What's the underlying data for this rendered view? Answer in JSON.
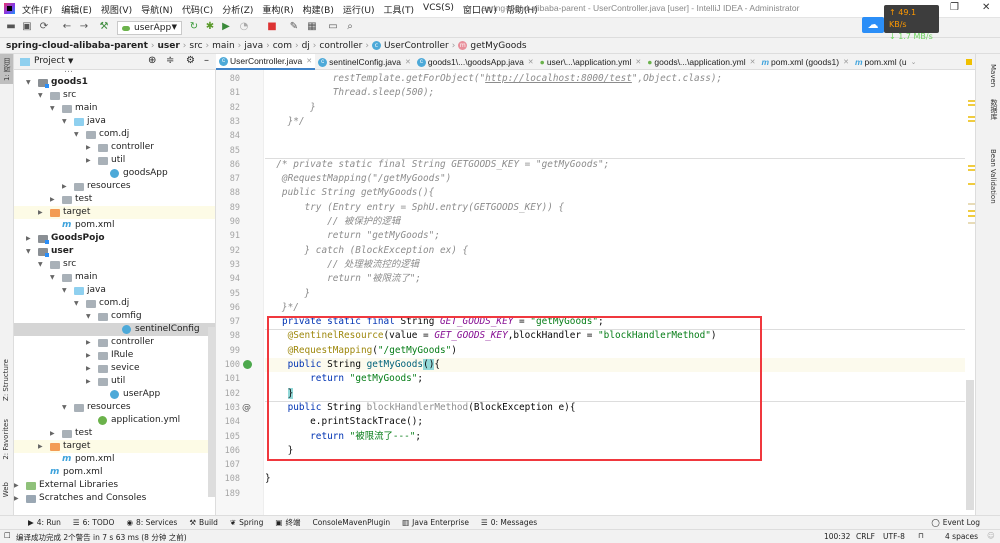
{
  "window": {
    "title": "spring-cloud-alibaba-parent - UserController.java [user] - IntelliJ IDEA - Administrator",
    "menu": [
      "文件(F)",
      "编辑(E)",
      "视图(V)",
      "导航(N)",
      "代码(C)",
      "分析(Z)",
      "重构(R)",
      "构建(B)",
      "运行(U)",
      "工具(T)",
      "VCS(S)",
      "窗口(W)",
      "帮助(H)"
    ]
  },
  "network": {
    "up": "↑ 49.1 KB/s",
    "down": "↓ 1.7 MB/s"
  },
  "toolbar": {
    "run_config": "userApp"
  },
  "breadcrumb": [
    "spring-cloud-alibaba-parent",
    "user",
    "src",
    "main",
    "java",
    "com",
    "dj",
    "controller",
    "UserController",
    "getMyGoods"
  ],
  "project_panel": {
    "title": "Project",
    "tree": [
      {
        "label": "goods1",
        "depth": 1,
        "icon": "mod",
        "open": true,
        "bold": true
      },
      {
        "label": "src",
        "depth": 2,
        "icon": "folder",
        "open": true
      },
      {
        "label": "main",
        "depth": 3,
        "icon": "folder",
        "open": true
      },
      {
        "label": "java",
        "depth": 4,
        "icon": "src",
        "open": true
      },
      {
        "label": "com.dj",
        "depth": 5,
        "icon": "folder",
        "open": true
      },
      {
        "label": "controller",
        "depth": 6,
        "icon": "folder",
        "open": false
      },
      {
        "label": "util",
        "depth": 6,
        "icon": "folder",
        "open": false
      },
      {
        "label": "goodsApp",
        "depth": 7,
        "icon": "cls"
      },
      {
        "label": "resources",
        "depth": 4,
        "icon": "folder",
        "open": false
      },
      {
        "label": "test",
        "depth": 3,
        "icon": "folder",
        "open": false
      },
      {
        "label": "target",
        "depth": 2,
        "icon": "orange",
        "open": false,
        "highlight": true
      },
      {
        "label": "pom.xml",
        "depth": 3,
        "icon": "m"
      },
      {
        "label": "GoodsPojo",
        "depth": 1,
        "icon": "mod",
        "open": false,
        "bold": true
      },
      {
        "label": "user",
        "depth": 1,
        "icon": "mod",
        "open": true,
        "bold": true
      },
      {
        "label": "src",
        "depth": 2,
        "icon": "folder",
        "open": true
      },
      {
        "label": "main",
        "depth": 3,
        "icon": "folder",
        "open": true
      },
      {
        "label": "java",
        "depth": 4,
        "icon": "src",
        "open": true
      },
      {
        "label": "com.dj",
        "depth": 5,
        "icon": "folder",
        "open": true
      },
      {
        "label": "comfig",
        "depth": 6,
        "icon": "folder",
        "open": true
      },
      {
        "label": "sentinelConfig",
        "depth": 8,
        "icon": "cls",
        "selected": true
      },
      {
        "label": "controller",
        "depth": 6,
        "icon": "folder",
        "open": false
      },
      {
        "label": "IRule",
        "depth": 6,
        "icon": "folder",
        "open": false
      },
      {
        "label": "sevice",
        "depth": 6,
        "icon": "folder",
        "open": false
      },
      {
        "label": "util",
        "depth": 6,
        "icon": "folder",
        "open": false
      },
      {
        "label": "userApp",
        "depth": 7,
        "icon": "cls"
      },
      {
        "label": "resources",
        "depth": 4,
        "icon": "folder",
        "open": true
      },
      {
        "label": "application.yml",
        "depth": 6,
        "icon": "yml"
      },
      {
        "label": "test",
        "depth": 3,
        "icon": "folder",
        "open": false
      },
      {
        "label": "target",
        "depth": 2,
        "icon": "orange",
        "open": false,
        "highlight": true
      },
      {
        "label": "pom.xml",
        "depth": 3,
        "icon": "m"
      },
      {
        "label": "pom.xml",
        "depth": 2,
        "icon": "m"
      },
      {
        "label": "External Libraries",
        "depth": 0,
        "icon": "lib",
        "open": false
      },
      {
        "label": "Scratches and Consoles",
        "depth": 0,
        "icon": "scr",
        "open": false
      }
    ]
  },
  "tabs": [
    {
      "label": "UserController.java",
      "icon": "c",
      "active": true
    },
    {
      "label": "sentinelConfig.java",
      "icon": "c"
    },
    {
      "label": "goods1\\...\\goodsApp.java",
      "icon": "c"
    },
    {
      "label": "user\\...\\application.yml",
      "icon": "yml"
    },
    {
      "label": "goods\\...\\application.yml",
      "icon": "yml"
    },
    {
      "label": "pom.xml (goods1)",
      "icon": "m"
    },
    {
      "label": "pom.xml (u",
      "icon": "m"
    }
  ],
  "editor": {
    "lines": [
      {
        "n": "80",
        "t": [
          [
            "            restTemplate.getForObject(\"",
            "c"
          ],
          [
            "http://localhost:8000/test",
            "cu"
          ],
          [
            "\",Object.class);",
            "c"
          ]
        ]
      },
      {
        "n": "81",
        "t": [
          [
            "            Thread.sleep(500);",
            "c"
          ]
        ]
      },
      {
        "n": "82",
        "t": [
          [
            "        }",
            "c"
          ]
        ]
      },
      {
        "n": "83",
        "t": [
          [
            "    }*/",
            "c"
          ]
        ]
      },
      {
        "n": "84",
        "t": []
      },
      {
        "n": "85",
        "t": []
      },
      {
        "n": "86",
        "t": [
          [
            "  /* private static final String GETGOODS_KEY = \"getMyGoods\";",
            "c"
          ]
        ]
      },
      {
        "n": "87",
        "t": [
          [
            "   @RequestMapping(\"/getMyGoods\")",
            "c"
          ]
        ]
      },
      {
        "n": "88",
        "t": [
          [
            "   public String getMyGoods(){",
            "c"
          ]
        ]
      },
      {
        "n": "89",
        "t": [
          [
            "       try (Entry entry = SphU.entry(GETGOODS_KEY)) {",
            "c"
          ]
        ]
      },
      {
        "n": "90",
        "t": [
          [
            "           // 被保护的逻辑",
            "c"
          ]
        ]
      },
      {
        "n": "91",
        "t": [
          [
            "           return \"getMyGoods\";",
            "c"
          ]
        ]
      },
      {
        "n": "92",
        "t": [
          [
            "       } catch (BlockException ex) {",
            "c"
          ]
        ]
      },
      {
        "n": "93",
        "t": [
          [
            "           // 处理被流控的逻辑",
            "c"
          ]
        ]
      },
      {
        "n": "94",
        "t": [
          [
            "           return \"被限流了\";",
            "c"
          ]
        ]
      },
      {
        "n": "95",
        "t": [
          [
            "       }",
            "c"
          ]
        ]
      },
      {
        "n": "96",
        "t": [
          [
            "   }*/",
            "c"
          ]
        ]
      },
      {
        "n": "97",
        "t": [
          [
            "   ",
            ""
          ],
          [
            "private static final ",
            "k"
          ],
          [
            "String ",
            ""
          ],
          [
            "GET_GOODS_KEY",
            "f"
          ],
          [
            " = ",
            ""
          ],
          [
            "\"getMyGoods\"",
            "s"
          ],
          [
            ";",
            ""
          ]
        ]
      },
      {
        "n": "98",
        "t": [
          [
            "    ",
            ""
          ],
          [
            "@SentinelResource",
            "a"
          ],
          [
            "(value = ",
            ""
          ],
          [
            "GET_GOODS_KEY",
            "f"
          ],
          [
            ",blockHandler = ",
            ""
          ],
          [
            "\"blockHandlerMethod\"",
            "s"
          ],
          [
            ")",
            ""
          ]
        ]
      },
      {
        "n": "99",
        "t": [
          [
            "    ",
            ""
          ],
          [
            "@RequestMapping",
            "a"
          ],
          [
            "(",
            ""
          ],
          [
            "\"/getMyGoods\"",
            "s"
          ],
          [
            ")",
            ""
          ]
        ]
      },
      {
        "n": "100",
        "cur": true,
        "t": [
          [
            "    ",
            ""
          ],
          [
            "public ",
            "k"
          ],
          [
            "String ",
            ""
          ],
          [
            "getMyGoods",
            "m"
          ],
          [
            "()",
            "bm"
          ],
          [
            "{",
            ""
          ]
        ]
      },
      {
        "n": "101",
        "t": [
          [
            "        ",
            ""
          ],
          [
            "return ",
            "k"
          ],
          [
            "\"getMyGoods\"",
            "s"
          ],
          [
            ";",
            ""
          ]
        ]
      },
      {
        "n": "102",
        "t": [
          [
            "    ",
            ""
          ],
          [
            "}",
            "bm"
          ]
        ]
      },
      {
        "n": "103",
        "t": [
          [
            "    ",
            ""
          ],
          [
            "public ",
            "k"
          ],
          [
            "String ",
            ""
          ],
          [
            "blockHandlerMethod",
            "u"
          ],
          [
            "(BlockException e){",
            ""
          ]
        ]
      },
      {
        "n": "104",
        "t": [
          [
            "        e.printStackTrace();",
            ""
          ]
        ]
      },
      {
        "n": "105",
        "t": [
          [
            "        ",
            ""
          ],
          [
            "return ",
            "k"
          ],
          [
            "\"被限流了---\"",
            "s"
          ],
          [
            ";",
            ""
          ]
        ]
      },
      {
        "n": "106",
        "t": [
          [
            "    }",
            ""
          ]
        ]
      },
      {
        "n": "107",
        "t": []
      },
      {
        "n": "108",
        "t": [
          [
            "}",
            ""
          ]
        ]
      },
      {
        "n": "189",
        "t": []
      }
    ]
  },
  "right_strip": [
    "Maven",
    "数据库",
    "Bean Validation"
  ],
  "left_strip": [
    "1: 项目",
    "Z: Structure",
    "2: Favorites",
    "Web"
  ],
  "bottom_tools": [
    "4: Run",
    "6: TODO",
    "8: Services",
    "Build",
    "Spring",
    "终端",
    "ConsoleMavenPlugin",
    "Java Enterprise",
    "0: Messages"
  ],
  "event_log": "Event Log",
  "status": {
    "message": "编译成功完成 2个警告 in 7 s 63 ms (8 分钟 之前)",
    "position": "100:32",
    "line_sep": "CRLF",
    "encoding": "UTF-8",
    "indent": "4 spaces"
  }
}
